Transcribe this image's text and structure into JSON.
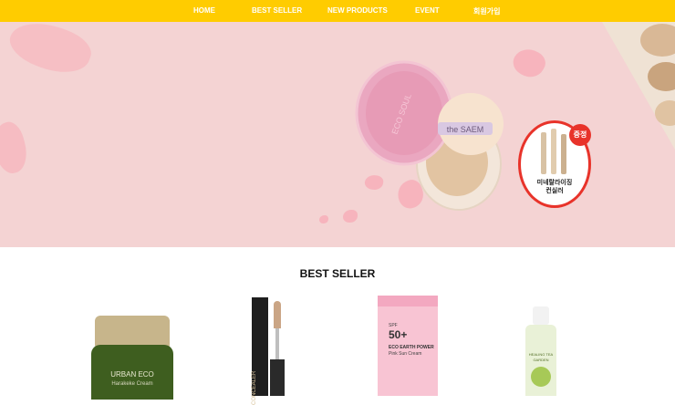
{
  "nav": {
    "items": [
      {
        "label": "HOME"
      },
      {
        "label": "BEST SELLER"
      },
      {
        "label": "NEW PRODUCTS"
      },
      {
        "label": "EVENT"
      },
      {
        "label": "회원가입"
      }
    ]
  },
  "hero": {
    "brand_puff_text": "the SAEM",
    "compact_lid_text": "ECO SOUL",
    "gift_badge": "증정",
    "gift_caption_line1": "미네랄라이징",
    "gift_caption_line2": "컨실러"
  },
  "best_seller": {
    "title": "BEST SELLER",
    "products": [
      {
        "label_line1": "URBAN ECO",
        "label_line2": "Harakeke Cream"
      },
      {
        "label_line1": "CONCEALER"
      },
      {
        "label_line1": "SPF",
        "label_line2": "50+",
        "label_line3": "ECO EARTH POWER",
        "label_line4": "Pink Sun Cream"
      },
      {
        "label_line1": "HEALING TEA",
        "label_line2": "GARDEN"
      }
    ]
  },
  "colors": {
    "nav": "#ffcc00",
    "hero_bg": "#f4d3d3",
    "accent_red": "#e8332a"
  }
}
